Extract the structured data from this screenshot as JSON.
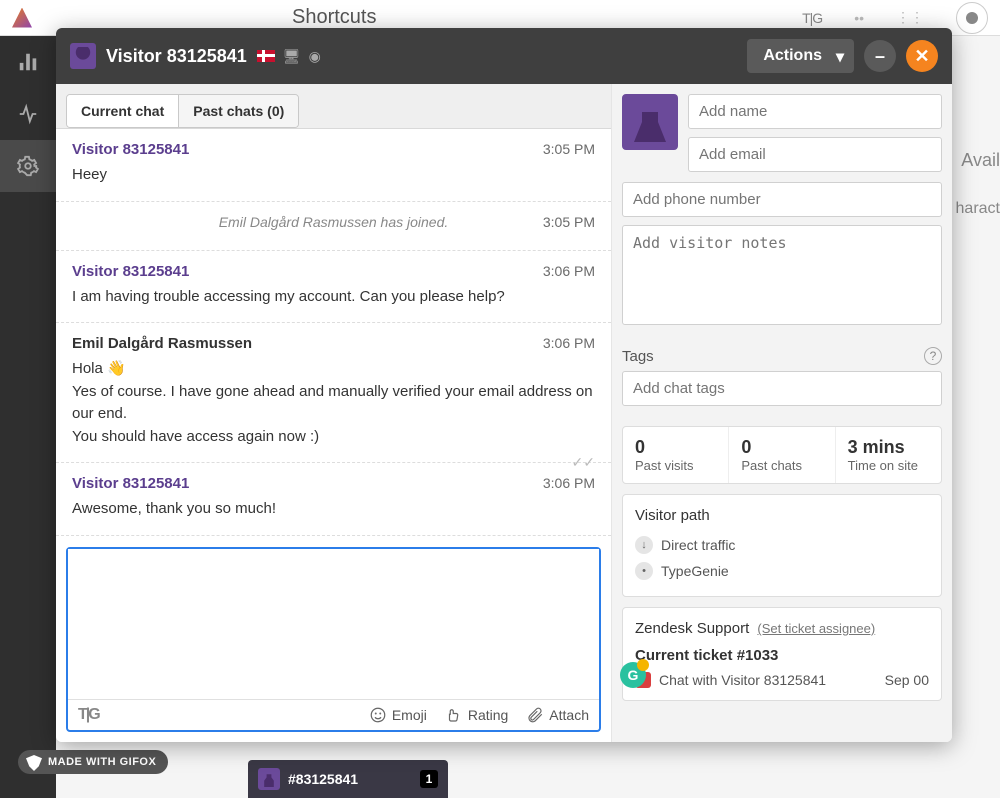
{
  "bg": {
    "shortcuts": "Shortcuts",
    "avail": "Avail",
    "charact": "haract",
    "tg": "T|G"
  },
  "gifox": "MADE WITH GIFOX",
  "bottom_tab": {
    "label": "#83125841",
    "badge": "1"
  },
  "modal": {
    "title": "Visitor 83125841",
    "actions": "Actions"
  },
  "tabs": {
    "current": "Current chat",
    "past": "Past chats (0)"
  },
  "messages": [
    {
      "kind": "visitor",
      "name": "Visitor 83125841",
      "time": "3:05 PM",
      "lines": [
        "Heey"
      ]
    },
    {
      "kind": "system",
      "text": "Emil Dalgård Rasmussen has joined.",
      "time": "3:05 PM"
    },
    {
      "kind": "visitor",
      "name": "Visitor 83125841",
      "time": "3:06 PM",
      "lines": [
        "I am having trouble accessing my account. Can you please help?"
      ]
    },
    {
      "kind": "agent",
      "name": "Emil Dalgård Rasmussen",
      "time": "3:06 PM",
      "lines": [
        "Hola 👋",
        "Yes of course. I have gone ahead and manually verified your email address on our end.",
        "You should have access again now :)"
      ],
      "checks": true
    },
    {
      "kind": "visitor",
      "name": "Visitor 83125841",
      "time": "3:06 PM",
      "lines": [
        "Awesome, thank you so much!"
      ]
    }
  ],
  "composer": {
    "tg": "T|G",
    "emoji": "Emoji",
    "rating": "Rating",
    "attach": "Attach"
  },
  "side": {
    "name_ph": "Add name",
    "email_ph": "Add email",
    "phone_ph": "Add phone number",
    "notes_ph": "Add visitor notes",
    "tags_label": "Tags",
    "tags_ph": "Add chat tags",
    "stats": [
      {
        "val": "0",
        "lbl": "Past visits"
      },
      {
        "val": "0",
        "lbl": "Past chats"
      },
      {
        "val": "3 mins",
        "lbl": "Time on site"
      }
    ],
    "visitor_path_hdr": "Visitor path",
    "vp": [
      {
        "icon": "↓",
        "text": "Direct traffic"
      },
      {
        "icon": "•",
        "text": "TypeGenie"
      }
    ],
    "zendesk": {
      "title": "Zendesk Support",
      "assignee": "(Set ticket assignee)",
      "current": "Current ticket #1033",
      "ticket_title": "Chat with Visitor 83125841",
      "ticket_date": "Sep 00"
    }
  }
}
